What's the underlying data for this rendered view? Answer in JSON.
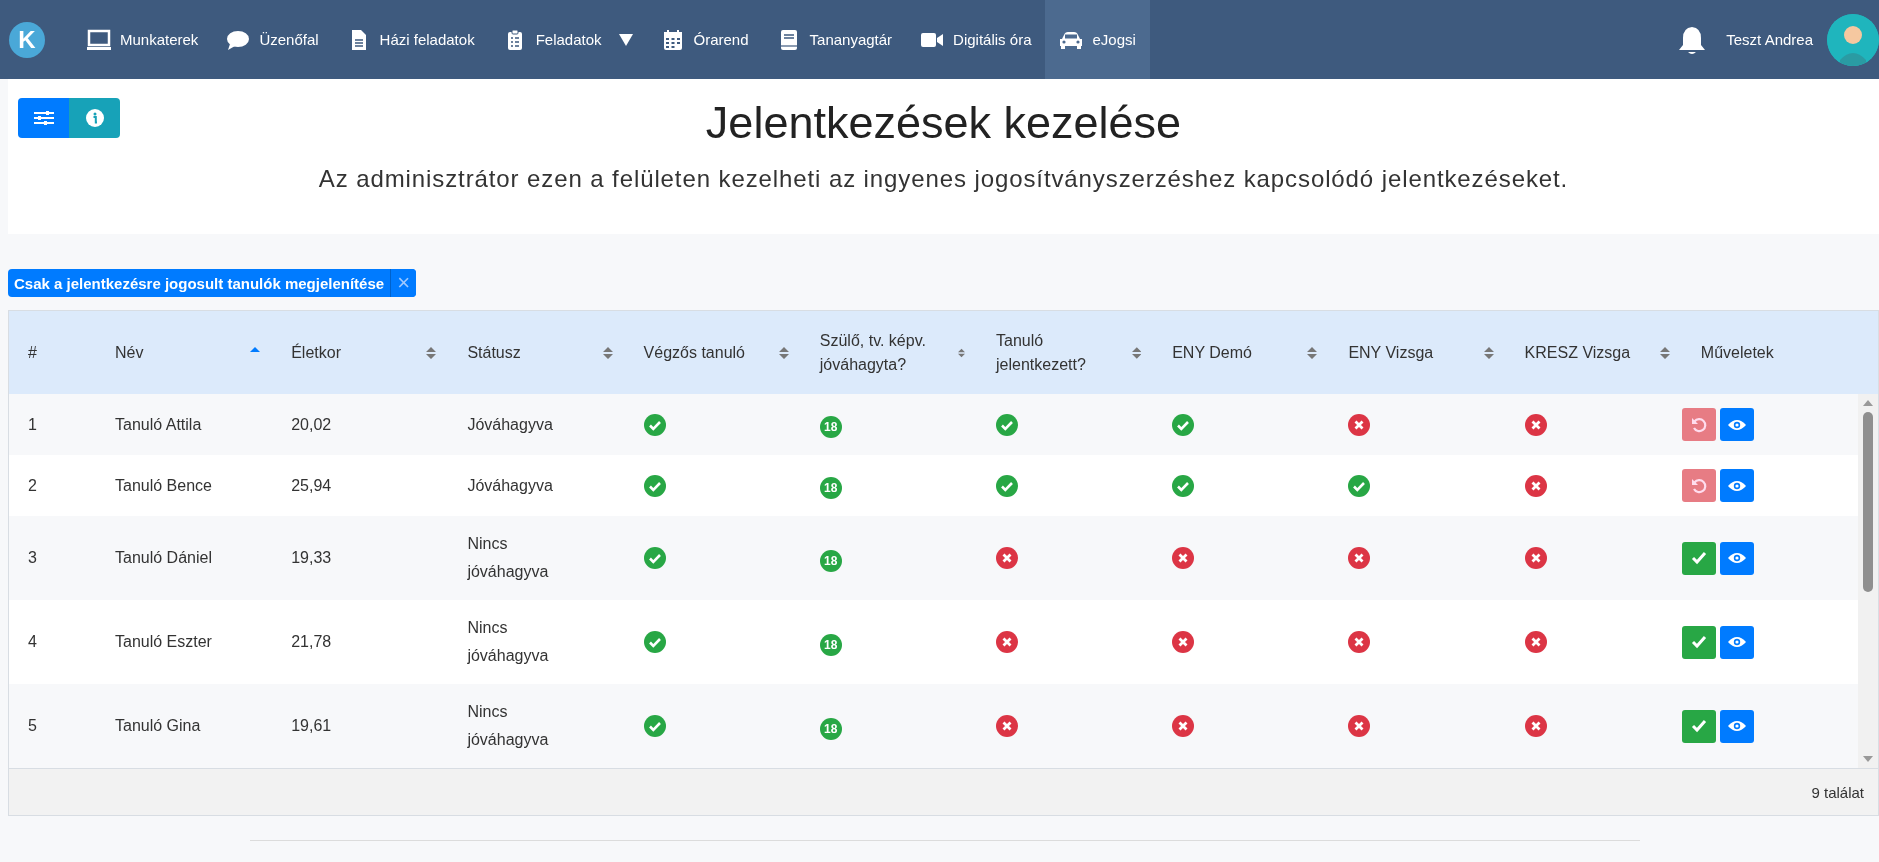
{
  "navbar": {
    "logo": "K",
    "items": [
      {
        "label": "Munkaterek",
        "kind": "monitor",
        "selected": false,
        "dropdown": false
      },
      {
        "label": "Üzenőfal",
        "kind": "chat",
        "selected": false,
        "dropdown": false
      },
      {
        "label": "Házi feladatok",
        "kind": "document",
        "selected": false,
        "dropdown": false
      },
      {
        "label": "Feladatok",
        "kind": "clipboard",
        "selected": false,
        "dropdown": true
      },
      {
        "label": "Órarend",
        "kind": "calendar",
        "selected": false,
        "dropdown": false
      },
      {
        "label": "Tananyagtár",
        "kind": "book",
        "selected": false,
        "dropdown": false
      },
      {
        "label": "Digitális óra",
        "kind": "video",
        "selected": false,
        "dropdown": false
      },
      {
        "label": "eJogsi",
        "kind": "car",
        "selected": true,
        "dropdown": false
      }
    ],
    "user": "Teszt Andrea"
  },
  "header": {
    "title": "Jelentkezések kezelése",
    "subtitle": "Az adminisztrátor ezen a felületen kezelheti az ingyenes jogosítványszerzéshez kapcsolódó jelentkezéseket."
  },
  "filter_chip": {
    "label": "Csak a jelentkezésre jogosult tanulók megjelenítése",
    "close": "×"
  },
  "table": {
    "columns": [
      {
        "label": "#",
        "sortable": false
      },
      {
        "label": "Név",
        "sortable": true,
        "sorted": true
      },
      {
        "label": "Életkor",
        "sortable": true,
        "sorted": false
      },
      {
        "label": "Státusz",
        "sortable": true,
        "sorted": false
      },
      {
        "label": "Végzős tanuló",
        "sortable": true,
        "sorted": false
      },
      {
        "label": "Szülő, tv. képv. jóváhagyta?",
        "sortable": true,
        "sorted": false
      },
      {
        "label": "Tanuló jelentkezett?",
        "sortable": true,
        "sorted": false
      },
      {
        "label": "ENY Demó",
        "sortable": true,
        "sorted": false
      },
      {
        "label": "ENY Vizsga",
        "sortable": true,
        "sorted": false
      },
      {
        "label": "KRESZ Vizsga",
        "sortable": true,
        "sorted": false
      },
      {
        "label": "Műveletek",
        "sortable": false
      }
    ],
    "rows": [
      {
        "num": "1",
        "name": "Tanuló Attila",
        "age": "20,02",
        "status": "Jóváhagyva",
        "marks": [
          {
            "kind": "yes"
          },
          {
            "kind": "age",
            "text": "18"
          },
          {
            "kind": "yes"
          },
          {
            "kind": "yes"
          },
          {
            "kind": "no"
          },
          {
            "kind": "no"
          }
        ],
        "action": {
          "kind": "revoke"
        }
      },
      {
        "num": "2",
        "name": "Tanuló Bence",
        "age": "25,94",
        "status": "Jóváhagyva",
        "marks": [
          {
            "kind": "yes"
          },
          {
            "kind": "age",
            "text": "18"
          },
          {
            "kind": "yes"
          },
          {
            "kind": "yes"
          },
          {
            "kind": "yes"
          },
          {
            "kind": "no"
          }
        ],
        "action": {
          "kind": "revoke"
        }
      },
      {
        "num": "3",
        "name": "Tanuló Dániel",
        "age": "19,33",
        "status": "Nincs jóváhagyva",
        "marks": [
          {
            "kind": "yes"
          },
          {
            "kind": "age",
            "text": "18"
          },
          {
            "kind": "no"
          },
          {
            "kind": "no"
          },
          {
            "kind": "no"
          },
          {
            "kind": "no"
          }
        ],
        "action": {
          "kind": "approve"
        }
      },
      {
        "num": "4",
        "name": "Tanuló Eszter",
        "age": "21,78",
        "status": "Nincs jóváhagyva",
        "marks": [
          {
            "kind": "yes"
          },
          {
            "kind": "age",
            "text": "18"
          },
          {
            "kind": "no"
          },
          {
            "kind": "no"
          },
          {
            "kind": "no"
          },
          {
            "kind": "no"
          }
        ],
        "action": {
          "kind": "approve"
        }
      },
      {
        "num": "5",
        "name": "Tanuló Gina",
        "age": "19,61",
        "status": "Nincs jóváhagyva",
        "marks": [
          {
            "kind": "yes"
          },
          {
            "kind": "age",
            "text": "18"
          },
          {
            "kind": "no"
          },
          {
            "kind": "no"
          },
          {
            "kind": "no"
          },
          {
            "kind": "no"
          }
        ],
        "action": {
          "kind": "approve"
        }
      }
    ],
    "footer": "9 találat"
  }
}
